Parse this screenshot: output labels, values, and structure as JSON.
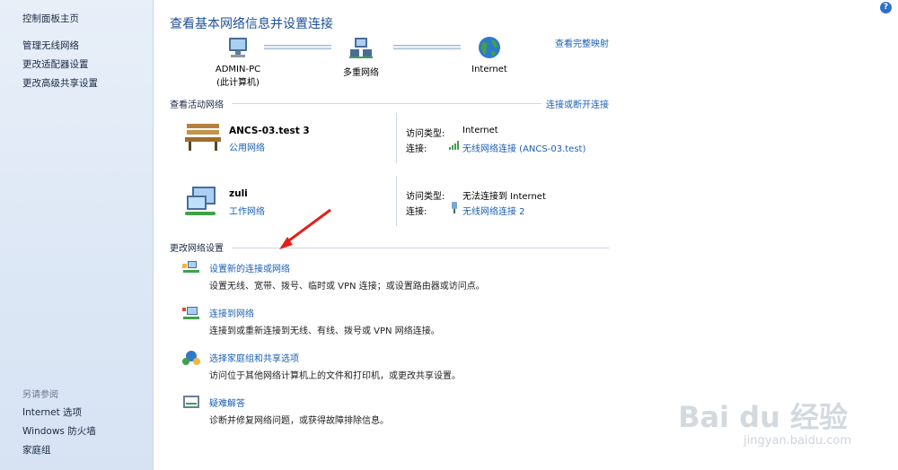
{
  "sidebar": {
    "home": "控制面板主页",
    "items": [
      "管理无线网络",
      "更改适配器设置",
      "更改高级共享设置"
    ],
    "see_also_label": "另请参阅",
    "see_also": [
      "Internet 选项",
      "Windows 防火墙",
      "家庭组"
    ]
  },
  "page": {
    "title": "查看基本网络信息并设置连接",
    "view_full_map": "查看完整映射",
    "help": "?"
  },
  "map": {
    "pc_name": "ADMIN-PC",
    "pc_sub": "(此计算机)",
    "multi": "多重网络",
    "internet": "Internet"
  },
  "active": {
    "section": "查看活动网络",
    "action": "连接或断开连接",
    "networks": [
      {
        "name": "ANCS-03.test  3",
        "type": "公用网络",
        "access_label": "访问类型:",
        "access_value": "Internet",
        "conn_label": "连接:",
        "conn_value": "无线网络连接 (ANCS-03.test)"
      },
      {
        "name": "zuli",
        "type": "工作网络",
        "access_label": "访问类型:",
        "access_value": "无法连接到 Internet",
        "conn_label": "连接:",
        "conn_value": "无线网络连接 2"
      }
    ]
  },
  "settings": {
    "section": "更改网络设置",
    "actions": [
      {
        "title": "设置新的连接或网络",
        "desc": "设置无线、宽带、拨号、临时或 VPN 连接；或设置路由器或访问点。"
      },
      {
        "title": "连接到网络",
        "desc": "连接到或重新连接到无线、有线、拨号或 VPN 网络连接。"
      },
      {
        "title": "选择家庭组和共享选项",
        "desc": "访问位于其他网络计算机上的文件和打印机，或更改共享设置。"
      },
      {
        "title": "疑难解答",
        "desc": "诊断并修复网络问题，或获得故障排除信息。"
      }
    ]
  },
  "watermark": {
    "logo": "Bai du 经验",
    "url": "jingyan.baidu.com"
  },
  "colors": {
    "link": "#1a5fb4",
    "title": "#1e4f9a",
    "sidebar_bg": "#dce7f5",
    "annotation_arrow": "#e0201b"
  }
}
